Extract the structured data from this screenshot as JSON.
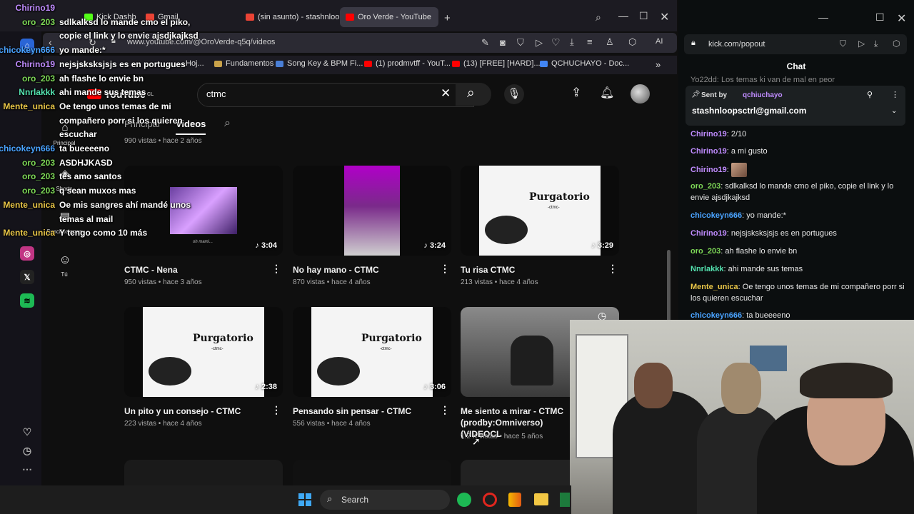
{
  "browser": {
    "tabs": [
      {
        "label": "Oro Verde - YouTube",
        "active": true
      },
      {
        "label": "(sin asunto) - stashnloopsctrl",
        "active": false
      },
      {
        "label": "Gmail",
        "active": false
      },
      {
        "label": "Kick Dashb",
        "active": false
      }
    ],
    "url": "www.youtube.com/@OroVerde-q5q/videos",
    "ai_label": "AI",
    "bookmarks": [
      "Hoj...",
      "Fundamentos",
      "Song Key & BPM Fi...",
      "(1) prodmvtff - YouT...",
      "(13) [FREE] [HARD]...",
      "QCHUCHAYO - Doc..."
    ]
  },
  "youtube": {
    "logo_text": "YouTube",
    "country": "CL",
    "search_value": "ctmc",
    "channel_tabs": [
      "Principal",
      "Videos"
    ],
    "left_nav": [
      "Principal",
      "Shorts",
      "Suscripciones",
      "Tú"
    ],
    "partial_meta": "990 vistas • hace 2 años",
    "videos": [
      {
        "title": "CTMC - Nena",
        "meta": "950 vistas • hace 3 años",
        "duration": "3:04",
        "thumb_text": "oh mami..."
      },
      {
        "title": "No hay mano - CTMC",
        "meta": "870 vistas • hace 4 años",
        "duration": "3:24",
        "thumb_text": ""
      },
      {
        "title": "Tu risa CTMC",
        "meta": "213 vistas • hace 4 años",
        "duration": "3:29",
        "thumb_text": "Purgatorio"
      },
      {
        "title": "Un pito y un consejo - CTMC",
        "meta": "223 vistas • hace 4 años",
        "duration": "2:38",
        "thumb_text": "Purgatorio"
      },
      {
        "title": "Pensando sin pensar - CTMC",
        "meta": "556 vistas • hace 4 años",
        "duration": "3:06",
        "thumb_text": "Purgatorio"
      },
      {
        "title": "Me siento a mirar - CTMC (prodby:Omniverso)(VIDEOCL",
        "meta": "1.2 K vistas • hace 5 años",
        "duration": "",
        "thumb_text": ""
      }
    ],
    "thumb_subtitle": "-ctmc-"
  },
  "overlay_chat": [
    {
      "user": "Chirino19",
      "msg": "",
      "color": "#c08cff"
    },
    {
      "user": "oro_203",
      "msg": "sdlkalksd lo mande cmo el piko,",
      "color": "#7ed957"
    },
    {
      "user": "",
      "msg": "copie el link y lo envie ajsdjkajksd",
      "color": "#7ed957"
    },
    {
      "user": "chicokeyn666",
      "msg": "yo mande:*",
      "color": "#4aa3ff"
    },
    {
      "user": "Chirino19",
      "msg": "nejsjsksksjsjs es en portugues",
      "color": "#c08cff"
    },
    {
      "user": "oro_203",
      "msg": "ah flashe lo envie bn",
      "color": "#7ed957"
    },
    {
      "user": "Nnrlakkk",
      "msg": "ahi mande sus temas",
      "color": "#54e3b0"
    },
    {
      "user": "Mente_unica",
      "msg": "Oe tengo unos temas de mi",
      "color": "#e8c547"
    },
    {
      "user": "",
      "msg": "compañero porr si los quieren",
      "color": "#e8c547"
    },
    {
      "user": "",
      "msg": "escuchar",
      "color": "#e8c547"
    },
    {
      "user": "chicokeyn666",
      "msg": "ta bueeeeno",
      "color": "#4aa3ff"
    },
    {
      "user": "oro_203",
      "msg": "ASDHJKASD",
      "color": "#7ed957"
    },
    {
      "user": "oro_203",
      "msg": "tes amo santos",
      "color": "#7ed957"
    },
    {
      "user": "oro_203",
      "msg": "q sean muxos mas",
      "color": "#7ed957"
    },
    {
      "user": "Mente_unica",
      "msg": "Oe mis sangres ahí mandé unos",
      "color": "#e8c547"
    },
    {
      "user": "",
      "msg": "temas al mail",
      "color": "#e8c547"
    },
    {
      "user": "Mente_unica",
      "msg": "Y tengo como 10 más",
      "color": "#e8c547"
    }
  ],
  "kick": {
    "url": "kick.com/popout",
    "header": "Chat",
    "top_partial": "Yo22dd: Los temas ki van de mal en peor",
    "pinned_sent_by": "Sent by",
    "pinned_user": "qchiuchayo",
    "pinned_msg": "stashnloopsctrl@gmail.com",
    "messages": [
      {
        "user": "Chirino19",
        "msg": "2/10",
        "color": "#c08cff"
      },
      {
        "user": "Chirino19",
        "msg": "a mi gusto",
        "color": "#c08cff"
      },
      {
        "user": "Chirino19",
        "msg": "",
        "color": "#c08cff"
      },
      {
        "user": "oro_203",
        "msg": "sdlkalksd lo mande cmo el piko, copie el link y lo envie ajsdjkajksd",
        "color": "#7ed957"
      },
      {
        "user": "chicokeyn666",
        "msg": "yo mande:*",
        "color": "#4aa3ff"
      },
      {
        "user": "Chirino19",
        "msg": "nejsjsksksjsjs es en portugues",
        "color": "#c08cff"
      },
      {
        "user": "oro_203",
        "msg": "ah flashe lo envie bn",
        "color": "#7ed957"
      },
      {
        "user": "Nnrlakkk",
        "msg": "ahi mande sus temas",
        "color": "#54e3b0"
      },
      {
        "user": "Mente_unica",
        "msg": "Oe tengo unos temas de mi compañero porr si los quieren escuchar",
        "color": "#e8c547"
      },
      {
        "user": "chicokeyn666",
        "msg": "ta bueeeeno",
        "color": "#4aa3ff"
      }
    ]
  },
  "taskbar": {
    "search_label": "Search"
  }
}
